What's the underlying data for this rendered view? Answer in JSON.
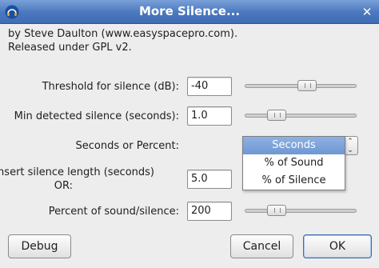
{
  "window": {
    "title": "More Silence...",
    "close_glyph": "✕",
    "icon": "audacity-app-icon"
  },
  "credits": {
    "line1": "by Steve Daulton (www.easyspacepro.com).",
    "line2": "Released under GPL v2."
  },
  "controls": {
    "threshold": {
      "label": "Threshold for silence (dB):",
      "value": "-40",
      "slider_fraction": 0.57
    },
    "min_silence": {
      "label": "Min detected silence (seconds):",
      "value": "1.0",
      "slider_fraction": 0.24
    },
    "mode": {
      "label": "Seconds or Percent:",
      "selected": "Seconds",
      "options": [
        "Seconds",
        "% of Sound",
        "% of Silence"
      ]
    },
    "insert_length": {
      "label_line1": "Insert silence length (seconds)",
      "label_line2": "OR:",
      "value": "5.0"
    },
    "percent": {
      "label": "Percent of sound/silence:",
      "value": "200",
      "slider_fraction": 0.24
    }
  },
  "buttons": {
    "debug": "Debug",
    "cancel": "Cancel",
    "ok": "OK"
  },
  "colors": {
    "titlebar": "#4a77bd",
    "selection": "#7a9fd8",
    "background": "#ededed"
  }
}
